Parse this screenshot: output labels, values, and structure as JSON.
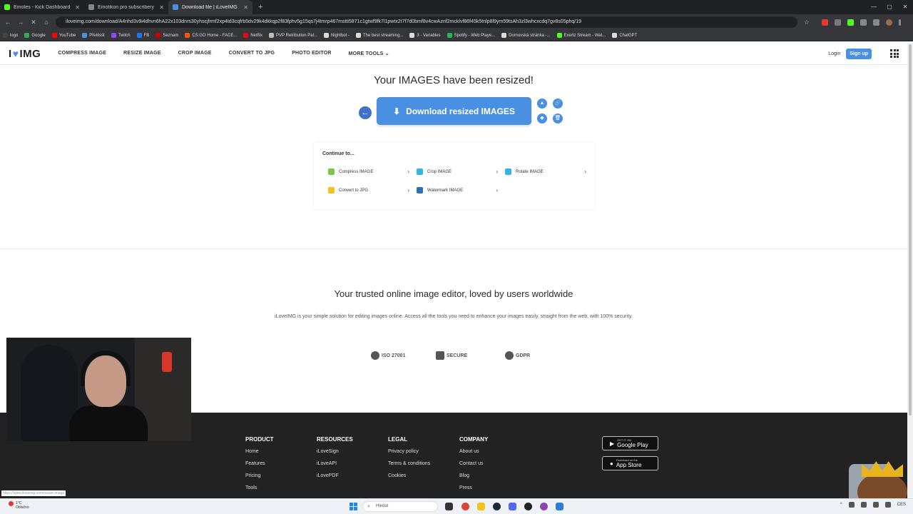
{
  "browser": {
    "tabs": [
      {
        "title": "Emotes - Kick Dashboard",
        "color": "#53fc18",
        "active": false
      },
      {
        "title": "Emotikon pro subscribery",
        "color": "#888888",
        "active": false
      },
      {
        "title": "Download file | iLoveIMG",
        "color": "#4a90e2",
        "active": true
      }
    ],
    "new_tab": "+",
    "url": "iloveimg.com/download/A4nhd3v9i4dhvn6hA22x103dnrs30yhscjfrmf2xp4td3cqfrb5dv29k4dkkqp2f83fphv5g15qs7j4tmrp467mstti5871c1gtwf9fk7l1pwtx2t7f7d0bmf8v4cwAznf2mcklvf86f45k5tnlp8l9ym59tsAh3zl3whcxcdq7gv8s05phq/19",
    "bookmarks": [
      {
        "label": "logo",
        "color": "#444444"
      },
      {
        "label": "Google",
        "color": "#34a853"
      },
      {
        "label": "YouTube",
        "color": "#ff0000"
      },
      {
        "label": "Překlsšt",
        "color": "#4a90e2"
      },
      {
        "label": "Twitch",
        "color": "#9146ff"
      },
      {
        "label": "FB",
        "color": "#1877f2"
      },
      {
        "label": "Seznam",
        "color": "#cc0000"
      },
      {
        "label": "CS:GO Home - FACE...",
        "color": "#ff5500"
      },
      {
        "label": "Netflix",
        "color": "#e50914"
      },
      {
        "label": "PVP Retribution Pal...",
        "color": "#bbbbbb"
      },
      {
        "label": "Nightbot -",
        "color": "#dddddd"
      },
      {
        "label": "The best streaming...",
        "color": "#dddddd"
      },
      {
        "label": "3 - Variables",
        "color": "#dddddd"
      },
      {
        "label": "Spotify - Web Playe...",
        "color": "#1db954"
      },
      {
        "label": "Domovská stránka -...",
        "color": "#dddddd"
      },
      {
        "label": "Exertz Stream - Wat...",
        "color": "#53fc18"
      },
      {
        "label": "ChatGPT",
        "color": "#dddddd"
      }
    ]
  },
  "header": {
    "logo_text_left": "I",
    "logo_text_right": "IMG",
    "menu": [
      "COMPRESS IMAGE",
      "RESIZE IMAGE",
      "CROP IMAGE",
      "CONVERT TO JPG",
      "PHOTO EDITOR",
      "MORE TOOLS"
    ],
    "login": "Login",
    "signup": "Sign up"
  },
  "main": {
    "title": "Your IMAGES have been resized!",
    "download_label": "Download resized IMAGES",
    "continue_title": "Continue to...",
    "continue_items": [
      {
        "label": "Compress IMAGE",
        "color": "#7ac64b"
      },
      {
        "label": "Crop IMAGE",
        "color": "#35b5e5"
      },
      {
        "label": "Rotate IMAGE",
        "color": "#35b5e5"
      },
      {
        "label": "Convert to JPG",
        "color": "#f2c31c"
      },
      {
        "label": "Watermark IMAGE",
        "color": "#2f6fb3"
      }
    ]
  },
  "trust": {
    "title": "Your trusted online image editor, loved by users worldwide",
    "text": "iLoveIMG is your simple solution for editing images online. Access all the tools you need to enhance your images easily, straight from the web, with 100% security.",
    "badges": [
      "ISO 27001",
      "SECURE",
      "GDPR"
    ]
  },
  "footer": {
    "columns": [
      {
        "title": "PRODUCT",
        "links": [
          "Home",
          "Features",
          "Pricing",
          "Tools"
        ]
      },
      {
        "title": "RESOURCES",
        "links": [
          "iLoveSign",
          "iLoveAPI",
          "iLovePDF"
        ]
      },
      {
        "title": "LEGAL",
        "links": [
          "Privacy policy",
          "Terms & conditions",
          "Cookies"
        ]
      },
      {
        "title": "COMPANY",
        "links": [
          "About us",
          "Contact us",
          "Blog",
          "Press"
        ]
      }
    ],
    "google_play_small": "GET IT ON",
    "google_play": "Google Play",
    "app_store_small": "Download on the",
    "app_store": "App Store"
  },
  "status_url": "https://www.iloveimg.com/resize-image",
  "taskbar": {
    "weather_temp": "1°C",
    "weather_text": "Oblačno",
    "search_placeholder": "Hledat",
    "tray_lang": "CES"
  }
}
